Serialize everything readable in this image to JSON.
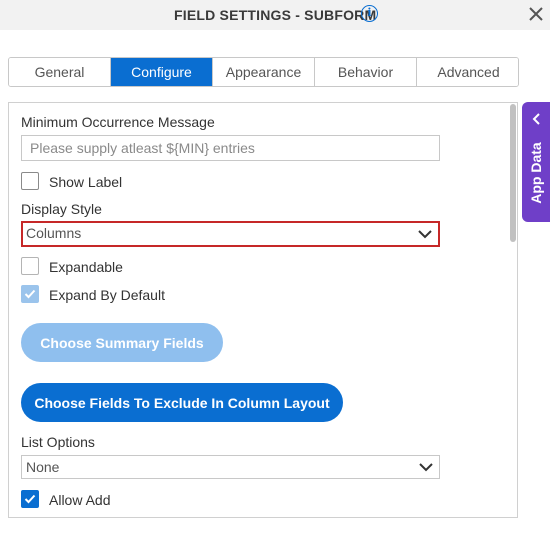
{
  "header": {
    "title": "FIELD SETTINGS - SUBFORM",
    "info_icon": "info-icon",
    "close_icon": "close-icon"
  },
  "tabs": [
    {
      "label": "General",
      "active": false
    },
    {
      "label": "Configure",
      "active": true
    },
    {
      "label": "Appearance",
      "active": false
    },
    {
      "label": "Behavior",
      "active": false
    },
    {
      "label": "Advanced",
      "active": false
    }
  ],
  "form": {
    "min_occurrence_label": "Minimum Occurrence Message",
    "min_occurrence_placeholder": "Please supply atleast ${MIN} entries",
    "show_label": {
      "label": "Show Label",
      "checked": false
    },
    "display_style_label": "Display Style",
    "display_style_value": "Columns",
    "expandable": {
      "label": "Expandable",
      "checked": false
    },
    "expand_by_default": {
      "label": "Expand By Default",
      "checked": true
    },
    "choose_summary_button": "Choose Summary Fields",
    "choose_exclude_button": "Choose Fields To Exclude In Column Layout",
    "list_options_label": "List Options",
    "list_options_value": "None",
    "allow_add": {
      "label": "Allow Add",
      "checked": true
    }
  },
  "side_panel": {
    "label": "App Data"
  },
  "colors": {
    "accent": "#0a6ed1",
    "side_panel": "#6f3fc8",
    "highlight_border": "#c62828"
  }
}
